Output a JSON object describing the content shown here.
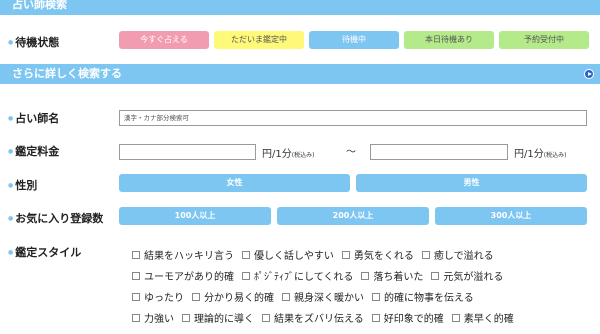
{
  "header": {
    "title": "占い師検索"
  },
  "wait_status": {
    "label": "待機状態",
    "buttons": [
      {
        "label": "今すぐ占える",
        "color": "#f29cb0"
      },
      {
        "label": "ただいま鑑定中",
        "color": "#fff97a"
      },
      {
        "label": "待機中",
        "color": "#7ec6f2"
      },
      {
        "label": "本日待機あり",
        "color": "#b4ea8a"
      },
      {
        "label": "予約受付中",
        "color": "#b4ea8a"
      }
    ]
  },
  "detail": {
    "title": "さらに詳しく検索する"
  },
  "name": {
    "label": "占い師名",
    "placeholder": "漢字・カナ部分検索可"
  },
  "fee": {
    "label": "鑑定料金",
    "unit": "円/1分",
    "unit_note": "(税込み)",
    "separator": "〜"
  },
  "gender": {
    "label": "性別",
    "options": [
      "女性",
      "男性"
    ]
  },
  "favorites": {
    "label": "お気に入り登録数",
    "options": [
      "100人以上",
      "200人以上",
      "300人以上"
    ]
  },
  "style": {
    "label": "鑑定スタイル",
    "rows": [
      [
        "結果をハッキリ言う",
        "優しく話しやすい",
        "勇気をくれる",
        "癒しで溢れる"
      ],
      [
        "ユーモアがあり的確",
        "ﾎﾟｼﾞﾃｨﾌﾞにしてくれる",
        "落ち着いた",
        "元気が溢れる"
      ],
      [
        "ゆったり",
        "分かり易く的確",
        "親身深く暖かい",
        "的確に物事を伝える"
      ],
      [
        "力強い",
        "理論的に導く",
        "結果をズバリ伝える",
        "好印象で的確",
        "素早く的確"
      ]
    ]
  }
}
